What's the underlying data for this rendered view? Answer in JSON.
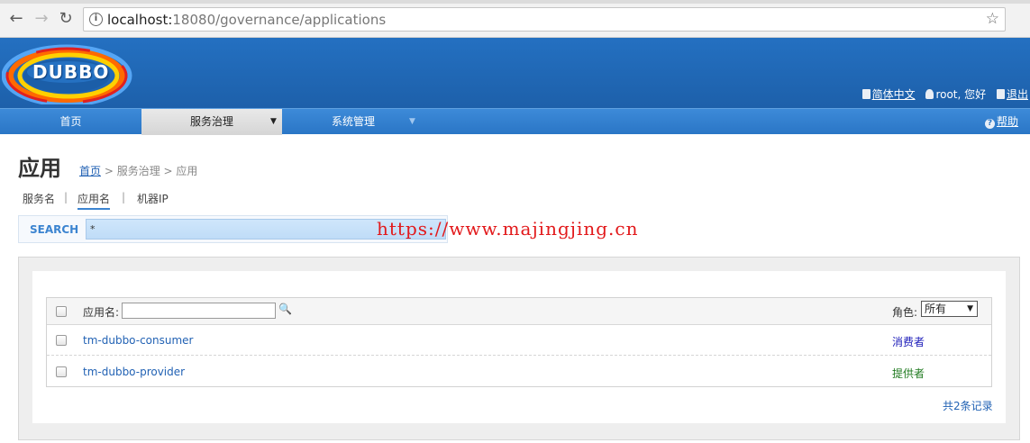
{
  "browser": {
    "url_host": "localhost:",
    "url_rest": "18080/governance/applications"
  },
  "header": {
    "logo_text": "DUBBO",
    "lang_link": "简体中文",
    "user_text": "root, 您好",
    "logout_link": "退出"
  },
  "menu": {
    "items": [
      {
        "label": "首页"
      },
      {
        "label": "服务治理"
      },
      {
        "label": "系统管理"
      }
    ],
    "help": "帮助"
  },
  "page": {
    "title": "应用",
    "breadcrumb_home": "首页",
    "breadcrumb_rest": " > 服务治理 > 应用",
    "subtabs": [
      "服务名",
      "应用名",
      "机器IP"
    ],
    "search_label": "SEARCH",
    "search_value": "*",
    "watermark": "https://www.majingjing.cn"
  },
  "table": {
    "filter_label": "应用名:",
    "role_label": "角色:",
    "role_selected": "所有",
    "rows": [
      {
        "name": "tm-dubbo-consumer",
        "role": "消费者"
      },
      {
        "name": "tm-dubbo-provider",
        "role": "提供者"
      }
    ],
    "total": "共2条记录"
  }
}
